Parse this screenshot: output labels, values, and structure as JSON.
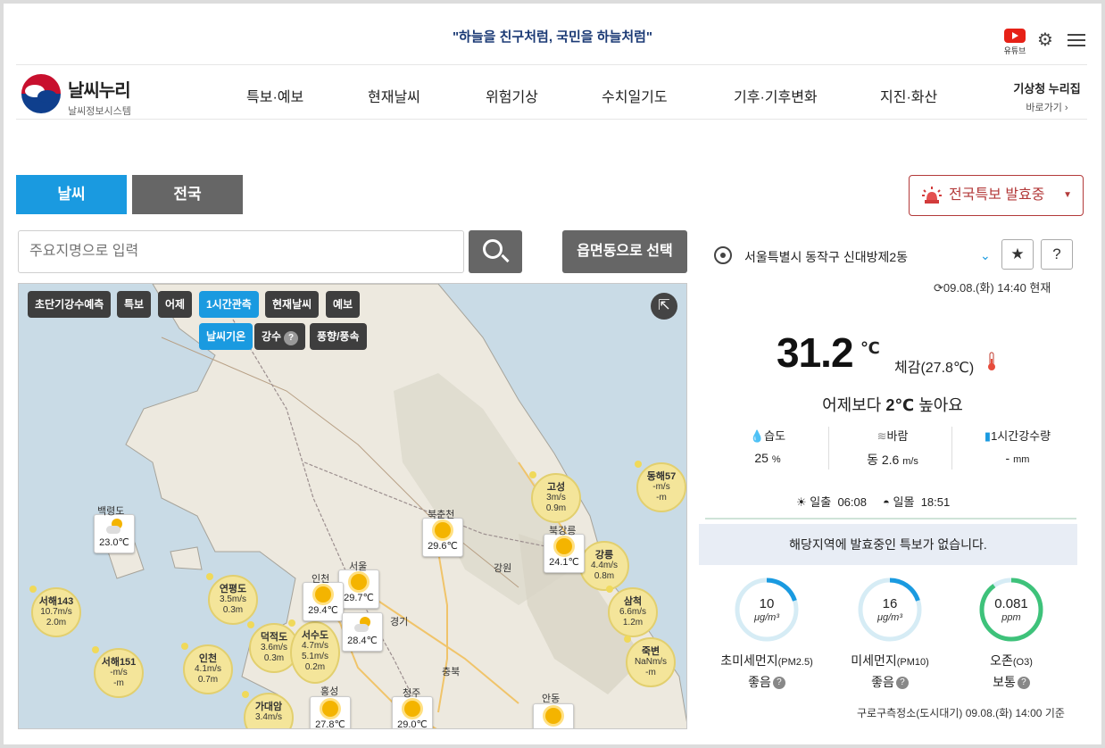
{
  "header": {
    "slogan": "\"하늘을 친구처럼, 국민을 하늘처럼\"",
    "youtube_label": "유튜브"
  },
  "nav": {
    "brand_name": "날씨누리",
    "brand_sub": "날씨정보시스템",
    "items": [
      "특보·예보",
      "현재날씨",
      "위험기상",
      "수치일기도",
      "기후·기후변화",
      "지진·화산"
    ],
    "right_title": "기상청 누리집",
    "right_sub": "바로가기 ›"
  },
  "tabs": {
    "weather": "날씨",
    "national": "전국"
  },
  "alert_button": "전국특보 발효중",
  "search": {
    "placeholder": "주요지명으로 입력",
    "town_button": "읍면동으로 선택"
  },
  "map": {
    "chips_row1": [
      "초단기강수예측",
      "특보",
      "어제",
      "1시간관측",
      "현재날씨",
      "예보"
    ],
    "chips_row2": [
      "날씨기온",
      "강수",
      "풍향/풍속"
    ],
    "active_chips": [
      "1시간관측",
      "날씨기온"
    ],
    "stations": [
      {
        "name": "동해57",
        "l1": "-m/s",
        "l2": "-m"
      },
      {
        "name": "고성",
        "l1": "3m/s",
        "l2": "0.9m"
      },
      {
        "name": "서해143",
        "l1": "10.7m/s",
        "l2": "2.0m"
      },
      {
        "name": "연평도",
        "l1": "3.5m/s",
        "l2": "0.3m"
      },
      {
        "name": "강릉",
        "l1": "4.4m/s",
        "l2": "0.8m"
      },
      {
        "name": "삼척",
        "l1": "6.6m/s",
        "l2": "1.2m"
      },
      {
        "name": "덕적도",
        "l1": "3.6m/s",
        "l2": "0.3m"
      },
      {
        "name": "서수도",
        "l1": "4.7m/s",
        "l2": ""
      },
      {
        "name": "서해151",
        "l1": "-m/s",
        "l2": "-m"
      },
      {
        "name": "인천",
        "l1": "4.1m/s",
        "l2": "0.7m"
      },
      {
        "name": "죽변",
        "l1": "NaNm/s",
        "l2": "-m"
      },
      {
        "name": "가대암",
        "l1": "3.4m/s",
        "l2": ""
      }
    ],
    "cards": [
      {
        "temp": "23.0℃",
        "icon": "partly-cloudy-icon"
      },
      {
        "temp": "29.6℃",
        "icon": "sun-icon"
      },
      {
        "temp": "24.1℃",
        "icon": "sun-icon"
      },
      {
        "temp": "29.7℃",
        "icon": "sun-icon"
      },
      {
        "temp": "29.4℃",
        "icon": "sun-icon"
      },
      {
        "temp": "28.4℃",
        "icon": "partly-cloudy-icon"
      },
      {
        "temp": "27.8℃",
        "icon": "sun-icon"
      },
      {
        "temp": "29.0℃",
        "icon": "sun-icon"
      },
      {
        "temp": "",
        "icon": "sun-icon"
      }
    ],
    "labels": [
      "백령도",
      "북춘천",
      "북강릉",
      "강원",
      "서울",
      "인천",
      "경기",
      "충북",
      "홍성",
      "청주",
      "안동"
    ],
    "extra": {
      "sudo_l2": "5.1m/s",
      "sudo_l3": "0.2m"
    }
  },
  "current": {
    "location": "서울특별시 동작구 신대방제2동",
    "updated": "09.08.(화) 14:40 현재",
    "temperature": "31.2",
    "temp_unit": "℃",
    "feels_like": "체감(27.8℃)",
    "compare_prefix": "어제보다 ",
    "compare_value": "2℃",
    "compare_suffix": " 높아요",
    "humidity_label": "습도",
    "humidity_value": "25",
    "humidity_unit": "%",
    "wind_label": "바람",
    "wind_value": "동 2.6",
    "wind_unit": "m/s",
    "rain_label": "1시간강수량",
    "rain_value": "-",
    "rain_unit": "mm",
    "sunrise_label": "일출",
    "sunrise": "06:08",
    "sunset_label": "일몰",
    "sunset": "18:51",
    "notice": "해당지역에 발효중인 특보가 없습니다."
  },
  "air": [
    {
      "value": "10",
      "unit": "μg/m³",
      "name": "초미세먼지",
      "code": "(PM2.5)",
      "grade": "좋음",
      "fraction": 0.2,
      "color": "#1a9ae0"
    },
    {
      "value": "16",
      "unit": "μg/m³",
      "name": "미세먼지",
      "code": "(PM10)",
      "grade": "좋음",
      "fraction": 0.2,
      "color": "#1a9ae0"
    },
    {
      "value": "0.081",
      "unit": "ppm",
      "name": "오존",
      "code": "(O3)",
      "grade": "보통",
      "fraction": 0.9,
      "color": "#3ec27a"
    }
  ],
  "air_station_note": "구로구측정소(도시대기) 09.08.(화) 14:00 기준"
}
